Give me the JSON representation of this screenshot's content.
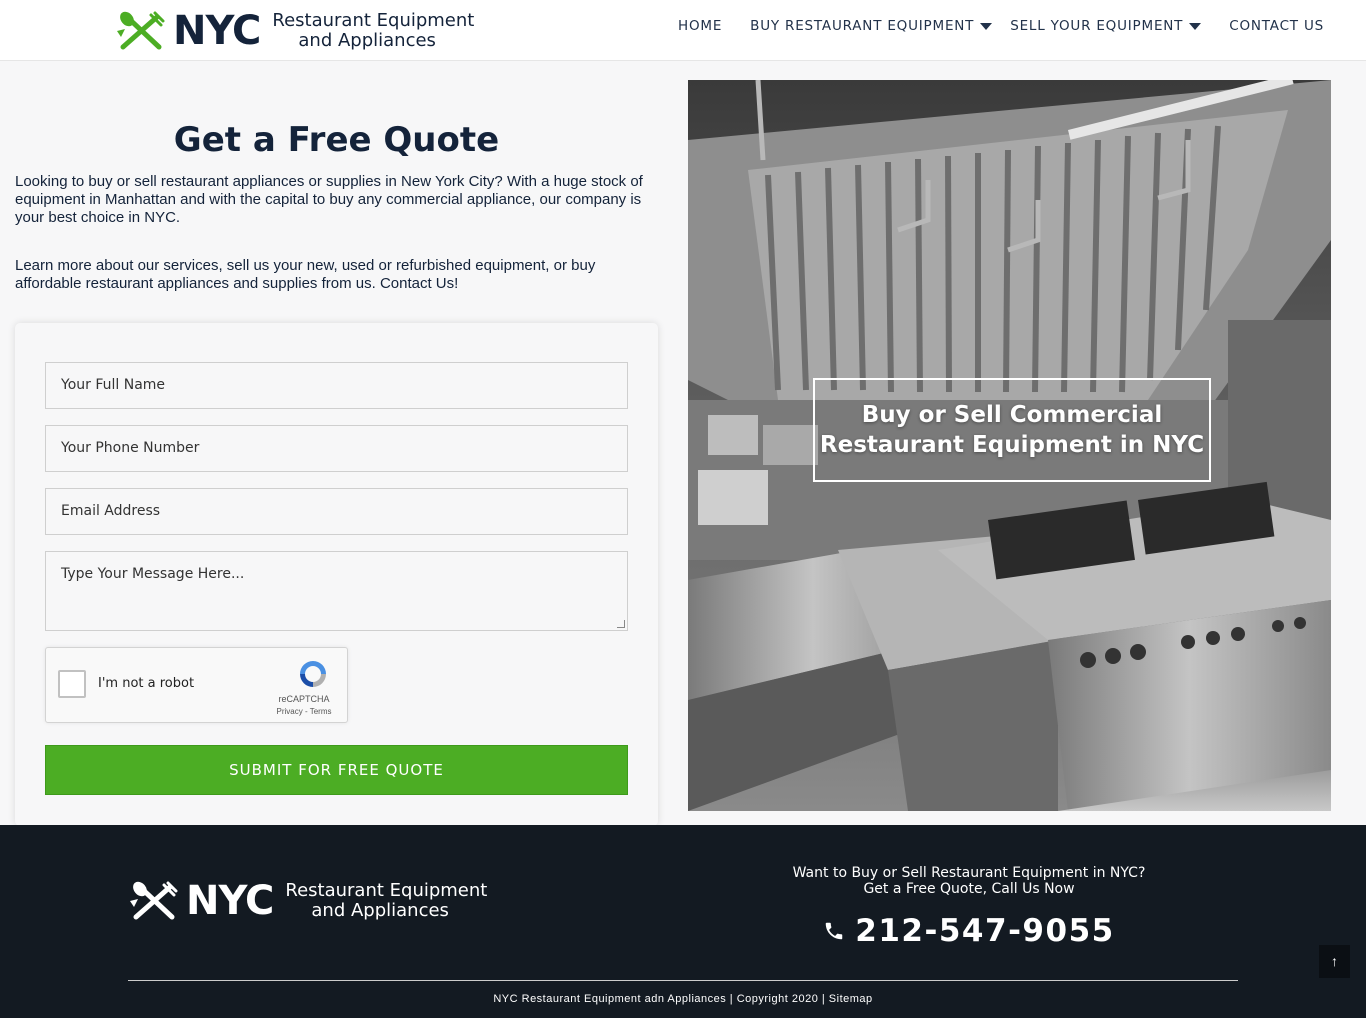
{
  "header": {
    "logo": {
      "nyc": "NYC",
      "line1": "Restaurant Equipment",
      "line2": "and Appliances"
    },
    "nav": [
      {
        "label": "HOME",
        "dropdown": false
      },
      {
        "label": "BUY RESTAURANT EQUIPMENT",
        "dropdown": true
      },
      {
        "label": "SELL YOUR EQUIPMENT",
        "dropdown": true
      },
      {
        "label": "CONTACT US",
        "dropdown": false
      }
    ]
  },
  "quote": {
    "title": "Get a Free Quote",
    "paragraph1": "Looking to buy or sell restaurant appliances or supplies in New York City? With a huge stock of equipment in Manhattan and with the capital to buy any commercial appliance, our company is your best choice in NYC.",
    "paragraph2": "Learn more about our services, sell us your new, used or refurbished equipment, or buy affordable restaurant appliances and supplies from us. Contact Us!"
  },
  "form": {
    "name_placeholder": "Your Full Name",
    "phone_placeholder": "Your Phone Number",
    "email_placeholder": "Email Address",
    "message_placeholder": "Type Your Message Here...",
    "recaptcha": {
      "label": "I'm not a robot",
      "brand": "reCAPTCHA",
      "links": "Privacy - Terms"
    },
    "submit_label": "SUBMIT FOR FREE QUOTE"
  },
  "hero": {
    "caption_line1": "Buy or Sell Commercial",
    "caption_line2": "Restaurant Equipment in NYC"
  },
  "footer": {
    "logo": {
      "nyc": "NYC",
      "line1": "Restaurant Equipment",
      "line2": "and Appliances"
    },
    "cta_line1": "Want to Buy or Sell Restaurant Equipment in NYC?",
    "cta_line2": "Get a Free Quote, Call Us Now",
    "phone": "212-547-9055",
    "copyright": "NYC Restaurant Equipment adn Appliances | Copyright 2020 | Sitemap",
    "to_top": "↑"
  },
  "colors": {
    "brand_green": "#4cad24",
    "navy": "#14233a",
    "footer_bg": "#131a22"
  }
}
